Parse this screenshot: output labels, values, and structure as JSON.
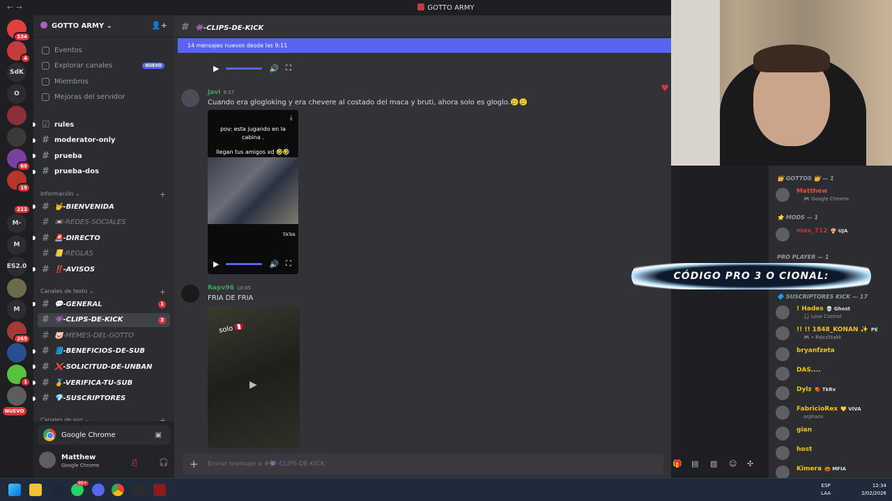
{
  "window_title": "GOTTO ARMY",
  "server": {
    "name": "GOTTO ARMY"
  },
  "guilds": [
    {
      "label": "",
      "badge": "534"
    },
    {
      "label": "",
      "badge": "4"
    },
    {
      "label": "SdK",
      "badge": ""
    },
    {
      "label": "O",
      "badge": ""
    },
    {
      "label": "",
      "badge": ""
    },
    {
      "label": "",
      "badge": ""
    },
    {
      "label": "",
      "badge": "69"
    },
    {
      "label": "",
      "badge": "19"
    },
    {
      "label": "",
      "badge": "212"
    },
    {
      "label": "M-",
      "badge": ""
    },
    {
      "label": "M",
      "badge": ""
    },
    {
      "label": "ES2.0",
      "badge": ""
    },
    {
      "label": "",
      "badge": ""
    },
    {
      "label": "M",
      "badge": ""
    },
    {
      "label": "",
      "badge": "265"
    },
    {
      "label": "",
      "badge": ""
    },
    {
      "label": "",
      "badge": "1"
    },
    {
      "label": "",
      "badge": ""
    }
  ],
  "guild_new": "NUEVO",
  "top_items": [
    {
      "label": "Eventos",
      "icon": "calendar-icon"
    },
    {
      "label": "Explorar canales",
      "icon": "explore-icon",
      "badge": "NUEVO"
    },
    {
      "label": "Miembros",
      "icon": "members-icon"
    },
    {
      "label": "Mejoras del servidor",
      "icon": "boost-icon"
    }
  ],
  "channels_a": [
    {
      "label": "rules",
      "kind": "rules"
    },
    {
      "label": "moderator-only",
      "kind": "hash"
    },
    {
      "label": "prueba",
      "kind": "hash"
    },
    {
      "label": "prueba-dos",
      "kind": "hash"
    }
  ],
  "cat_info": "Información",
  "channels_info": [
    {
      "label": "🤟-BIENVENIDA",
      "state": "bold"
    },
    {
      "label": "📼-REDES-SOCIALES",
      "state": "dim"
    },
    {
      "label": "🚨-DIRECTO",
      "state": "bold"
    },
    {
      "label": "📒-REGLAS",
      "state": "dim"
    },
    {
      "label": "‼️-AVISOS",
      "state": "bold"
    }
  ],
  "cat_text": "Canales de texto",
  "channels_text": [
    {
      "label": "💬-GENERAL",
      "state": "bold",
      "count": "1"
    },
    {
      "label": "👾-CLIPS-DE-KICK",
      "state": "active",
      "count": "3"
    },
    {
      "label": "🐷-MEMES-DEL-GOTTO",
      "state": "dim",
      "count": ""
    },
    {
      "label": "📘-BENEFICIOS-DE-SUB",
      "state": "bold",
      "count": ""
    },
    {
      "label": "❌-SOLICITUD-DE-UNBAN",
      "state": "bold",
      "count": ""
    },
    {
      "label": "🏅-VERIFICA-TU-SUB",
      "state": "bold",
      "count": ""
    },
    {
      "label": "💎-SUSCRIPTORES",
      "state": "bold",
      "count": ""
    }
  ],
  "cat_voice": "Canales de voz",
  "activity": {
    "app": "Google Chrome"
  },
  "user": {
    "name": "Matthew",
    "status": "Google Chrome"
  },
  "channel": {
    "name": "👾-CLIPS-DE-KICK"
  },
  "new_messages": "14 mensajes nuevos desde las 9:11",
  "messages": [
    {
      "author": "Javi",
      "time": "9:37",
      "color": "#3ba55d",
      "text": "Cuando era glogloking y era chevere al costado del maca y bruti, ahora solo es gloglo.🥲🥲",
      "video_caption_1": "pov: esta jugando en la cabina .",
      "video_caption_2": "llegan tus amigos xd 🤣🤣",
      "video_brand": "TikTok"
    },
    {
      "author": "Rapv96",
      "time": "10:05",
      "color": "#3ba55d",
      "text": "FRIA DE FRIA",
      "video_caption_1": "solo 🇵🇪"
    }
  ],
  "composer_placeholder": "Enviar mensaje a #👾-CLIPS-DE-KICK",
  "promo_text": "CÓDIGO PRO 3 O CIONAL:",
  "member_groups": [
    {
      "label": "👑 GOTTOS 👑 — 1",
      "members": [
        {
          "name": "Matthew",
          "status": "🎮 Google Chrome",
          "color": "#e74c3c"
        }
      ]
    },
    {
      "label": "⭐ MODS — 1",
      "members": [
        {
          "name": "max_712",
          "status": "",
          "color": "#c0392b",
          "tag": "🍄 UJA"
        }
      ]
    },
    {
      "label": "PRO PLAYER — 1",
      "members": []
    },
    {
      "label": "🔷 SUSCRIPTORES KICK — 17",
      "members": [
        {
          "name": "! Hades",
          "tag": "💀 Ghost",
          "status": "🎧 Lose Control",
          "color": "#f1c40f"
        },
        {
          "name": "!! !! 1848_KONAN ✨",
          "tag": "PE",
          "status": "🎮 • Rdxx5takk",
          "color": "#f1c40f"
        },
        {
          "name": "bryanfzeta",
          "tag": "",
          "status": "",
          "color": "#f1c40f"
        },
        {
          "name": "DAS....",
          "tag": "",
          "status": "",
          "color": "#f1c40f"
        },
        {
          "name": "Dylz",
          "tag": "🍓 TkRv",
          "status": "",
          "color": "#f1c40f"
        },
        {
          "name": "FabricioRex",
          "tag": "💛 VIVA",
          "status": "orphans",
          "color": "#f1c40f"
        },
        {
          "name": "gian",
          "tag": "",
          "status": "",
          "color": "#f1c40f"
        },
        {
          "name": "host",
          "tag": "",
          "status": "",
          "color": "#f1c40f"
        },
        {
          "name": "Kimera",
          "tag": "🎃 MFIA",
          "status": "",
          "color": "#f1c40f"
        }
      ]
    }
  ],
  "taskbar": {
    "lang1": "ESP",
    "lang2": "LAA",
    "time": "12:34",
    "date": "2/02/2026",
    "badge": "99+"
  }
}
